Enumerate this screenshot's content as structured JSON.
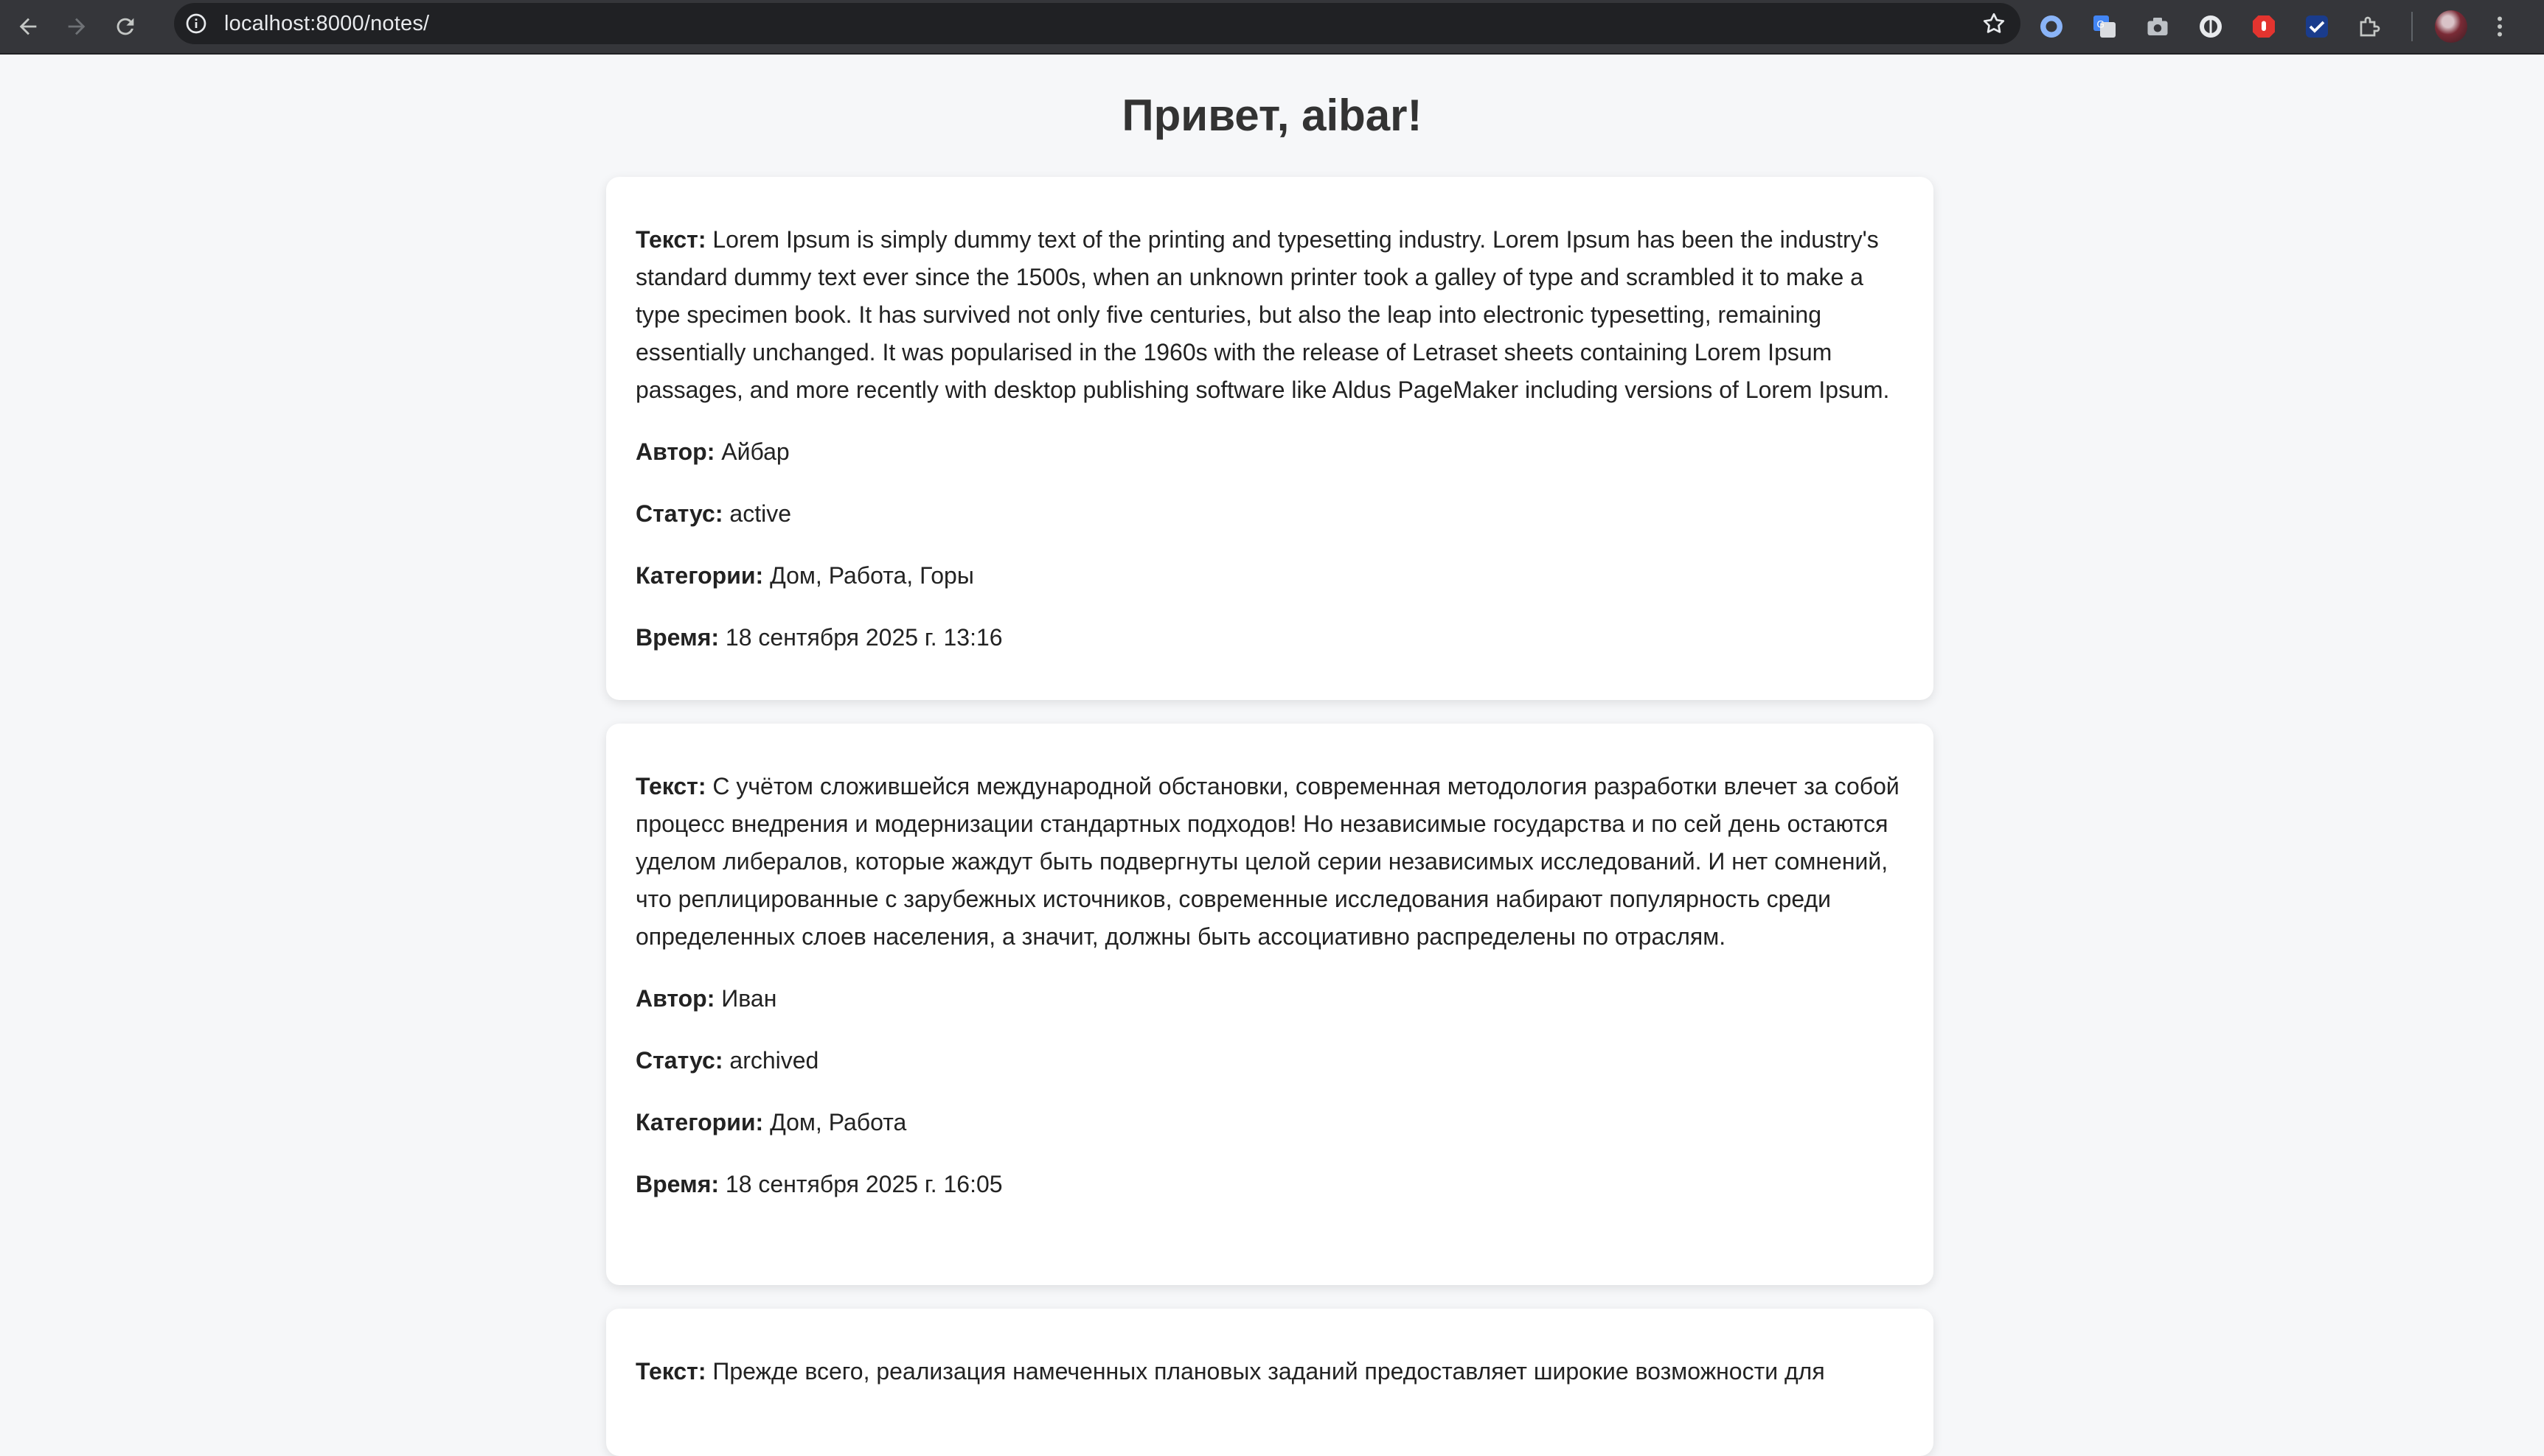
{
  "browser": {
    "url": "localhost:8000/notes/"
  },
  "page": {
    "greeting": "Привет, aibar!"
  },
  "labels": {
    "text": "Текст:",
    "author": "Автор:",
    "status": "Статус:",
    "categories": "Категории:",
    "time": "Время:"
  },
  "notes": [
    {
      "text": "Lorem Ipsum is simply dummy text of the printing and typesetting industry. Lorem Ipsum has been the industry's standard dummy text ever since the 1500s, when an unknown printer took a galley of type and scrambled it to make a type specimen book. It has survived not only five centuries, but also the leap into electronic typesetting, remaining essentially unchanged. It was popularised in the 1960s with the release of Letraset sheets containing Lorem Ipsum passages, and more recently with desktop publishing software like Aldus PageMaker including versions of Lorem Ipsum.",
      "author": "Айбар",
      "status": "active",
      "categories": "Дом, Работа, Горы",
      "time": "18 сентября 2025 г. 13:16"
    },
    {
      "text": "С учётом сложившейся международной обстановки, современная методология разработки влечет за собой процесс внедрения и модернизации стандартных подходов! Но независимые государства и по сей день остаются уделом либералов, которые жаждут быть подвергнуты целой серии независимых исследований. И нет сомнений, что реплицированные с зарубежных источников, современные исследования набирают популярность среди определенных слоев населения, а значит, должны быть ассоциативно распределены по отраслям.",
      "author": "Иван",
      "status": "archived",
      "categories": "Дом, Работа",
      "time": "18 сентября 2025 г. 16:05"
    },
    {
      "text": "Прежде всего, реализация намеченных плановых заданий предоставляет широкие возможности для"
    }
  ]
}
